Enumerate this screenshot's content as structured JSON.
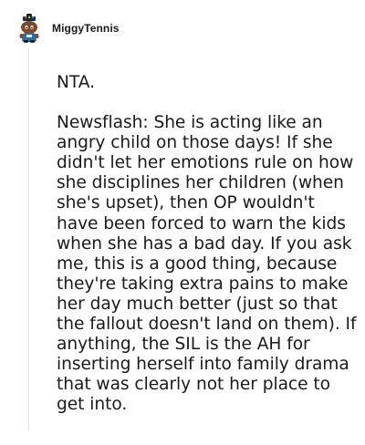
{
  "comment": {
    "author": "MiggyTennis",
    "avatar_icon": "snoo-avatar-icon",
    "paragraphs": [
      "NTA.",
      "Newsflash: She is acting like an angry child on those days! If she didn't let her emotions rule on how she disciplines her children (when she's upset), then OP wouldn't have been forced to warn the kids when she has a bad day. If you ask me, this is a good thing, because they're taking extra pains to make her day much better (just so that the fallout doesn't land on them). If anything, the SIL is the AH for inserting herself into family drama that was clearly not her place to get into."
    ]
  }
}
